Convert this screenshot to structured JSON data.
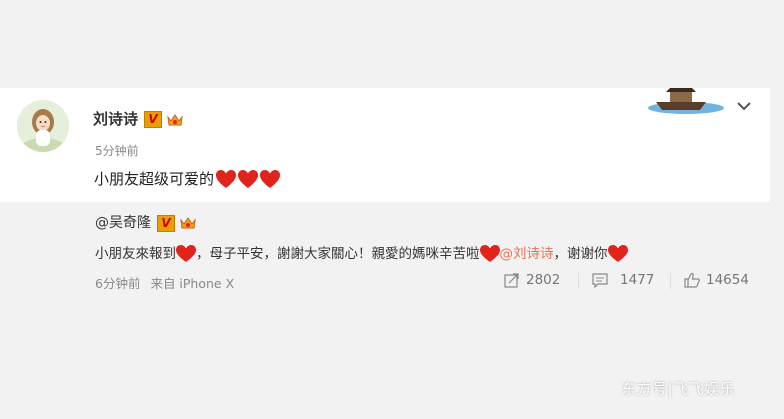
{
  "post": {
    "author": "刘诗诗",
    "verified_mark": "V",
    "time": "5分钟前",
    "text": "小朋友超级可爱的"
  },
  "repost": {
    "author": "@吴奇隆",
    "verified_mark": "V",
    "text_part1": "小朋友來報到",
    "text_part2": "，母子平安，謝謝大家關心！親愛的媽咪辛苦啦",
    "mention": "@刘诗诗",
    "text_part3": "，谢谢你",
    "time": "6分钟前",
    "source": "来自 iPhone X",
    "reposts": "2802",
    "comments": "1477",
    "likes": "14654"
  },
  "watermark": "东方号|飞飞娱乐",
  "colors": {
    "heart": "#e0231b",
    "mention": "#eb7350",
    "verified": "#e8a000"
  }
}
